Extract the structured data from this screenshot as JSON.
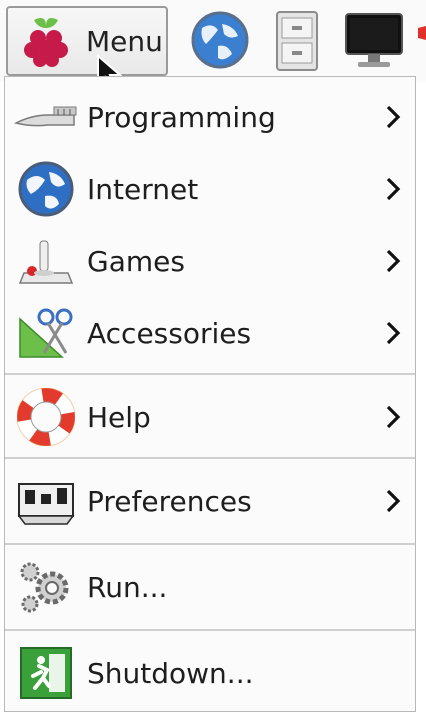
{
  "taskbar": {
    "menu_label": "Menu",
    "icons": [
      "raspberry-icon",
      "web-browser-icon",
      "file-manager-icon",
      "terminal-icon"
    ]
  },
  "menu": {
    "items": [
      {
        "label": "Programming",
        "icon": "programming-icon",
        "has_submenu": true
      },
      {
        "label": "Internet",
        "icon": "globe-icon",
        "has_submenu": true
      },
      {
        "label": "Games",
        "icon": "joystick-icon",
        "has_submenu": true
      },
      {
        "label": "Accessories",
        "icon": "scissors-ruler-icon",
        "has_submenu": true
      },
      {
        "label": "Help",
        "icon": "lifebuoy-icon",
        "has_submenu": true
      },
      {
        "label": "Preferences",
        "icon": "preferences-panel-icon",
        "has_submenu": true
      },
      {
        "label": "Run...",
        "icon": "gears-icon",
        "has_submenu": false
      },
      {
        "label": "Shutdown...",
        "icon": "exit-icon",
        "has_submenu": false
      }
    ]
  },
  "colors": {
    "raspberry": "#c51a4a",
    "leaf": "#6cc04a",
    "exit_green": "#3aa13a"
  }
}
